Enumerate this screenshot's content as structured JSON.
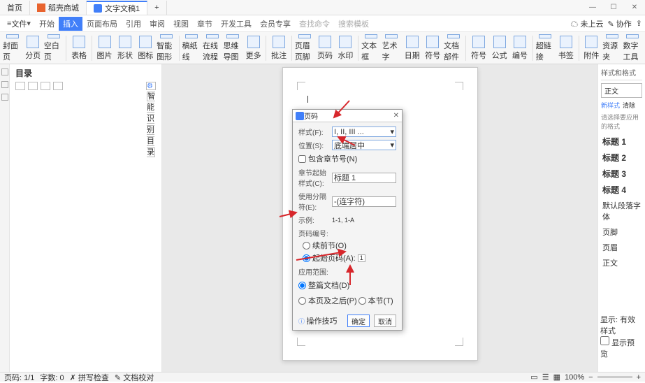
{
  "tabs": {
    "home": "首页",
    "rec": "稻壳商城",
    "doc": "文字文稿1",
    "plus": "+"
  },
  "menubar": {
    "file": "文件",
    "start": "开始",
    "insert": "插入",
    "layout": "页面布局",
    "ref": "引用",
    "review": "审阅",
    "view": "视图",
    "chapter": "章节",
    "dev": "开发工具",
    "vip": "会员专享",
    "findcmd": "查找命令",
    "search": "搜索模板",
    "unsync": "未上云",
    "coop": "协作"
  },
  "ribbon": [
    "封面页",
    "分页",
    "空白页",
    "表格",
    "图片",
    "形状",
    "图标",
    "智能图形",
    "稿纸线",
    "在线流程",
    "思维导图",
    "更多",
    "批注",
    "页眉页脚",
    "页码",
    "水印",
    "文本框",
    "艺术字",
    "日期",
    "符号",
    "文档部件",
    "符号",
    "公式",
    "编号",
    "超链接",
    "书签",
    "附件",
    "资源夹",
    "数字工具"
  ],
  "nav": {
    "title": "目录",
    "smart": "智能识别目录"
  },
  "dialog": {
    "title": "页码",
    "style_lbl": "样式(F):",
    "style_val": "I, II, III ...",
    "pos_lbl": "位置(S):",
    "pos_val": "底端居中",
    "chk_chapter": "包含章节号(N)",
    "chap_style_lbl": "章节起始样式(C):",
    "chap_style_val": "标题 1",
    "sep_lbl": "使用分隔符(E):",
    "sep_val": "-(连字符)",
    "example_lbl": "示例:",
    "example_val": "1-1, 1-A",
    "num_section": "页码编号:",
    "rad_continue": "续前节(O)",
    "rad_start": "起始页码(A):",
    "start_val": "1",
    "apply_section": "应用范围:",
    "rad_whole": "整篇文档(D)",
    "rad_from": "本页及之后(P)",
    "rad_this": "本节(T)",
    "tips": "操作技巧",
    "ok": "确定",
    "cancel": "取消"
  },
  "styles": {
    "title": "样式和格式",
    "current": "正文",
    "new": "新样式",
    "clear": "清除",
    "hint": "请选择要应用的格式",
    "items": [
      "标题 1",
      "标题 2",
      "标题 3",
      "标题 4",
      "默认段落字体",
      "页脚",
      "页眉",
      "正文"
    ],
    "show_lbl": "显示:",
    "show_val": "有效样式",
    "preview": "显示预览"
  },
  "status": {
    "page": "页码: 1/1",
    "words": "字数: 0",
    "spell": "拼写检查",
    "docfix": "文档校对",
    "zoom": "100%"
  }
}
